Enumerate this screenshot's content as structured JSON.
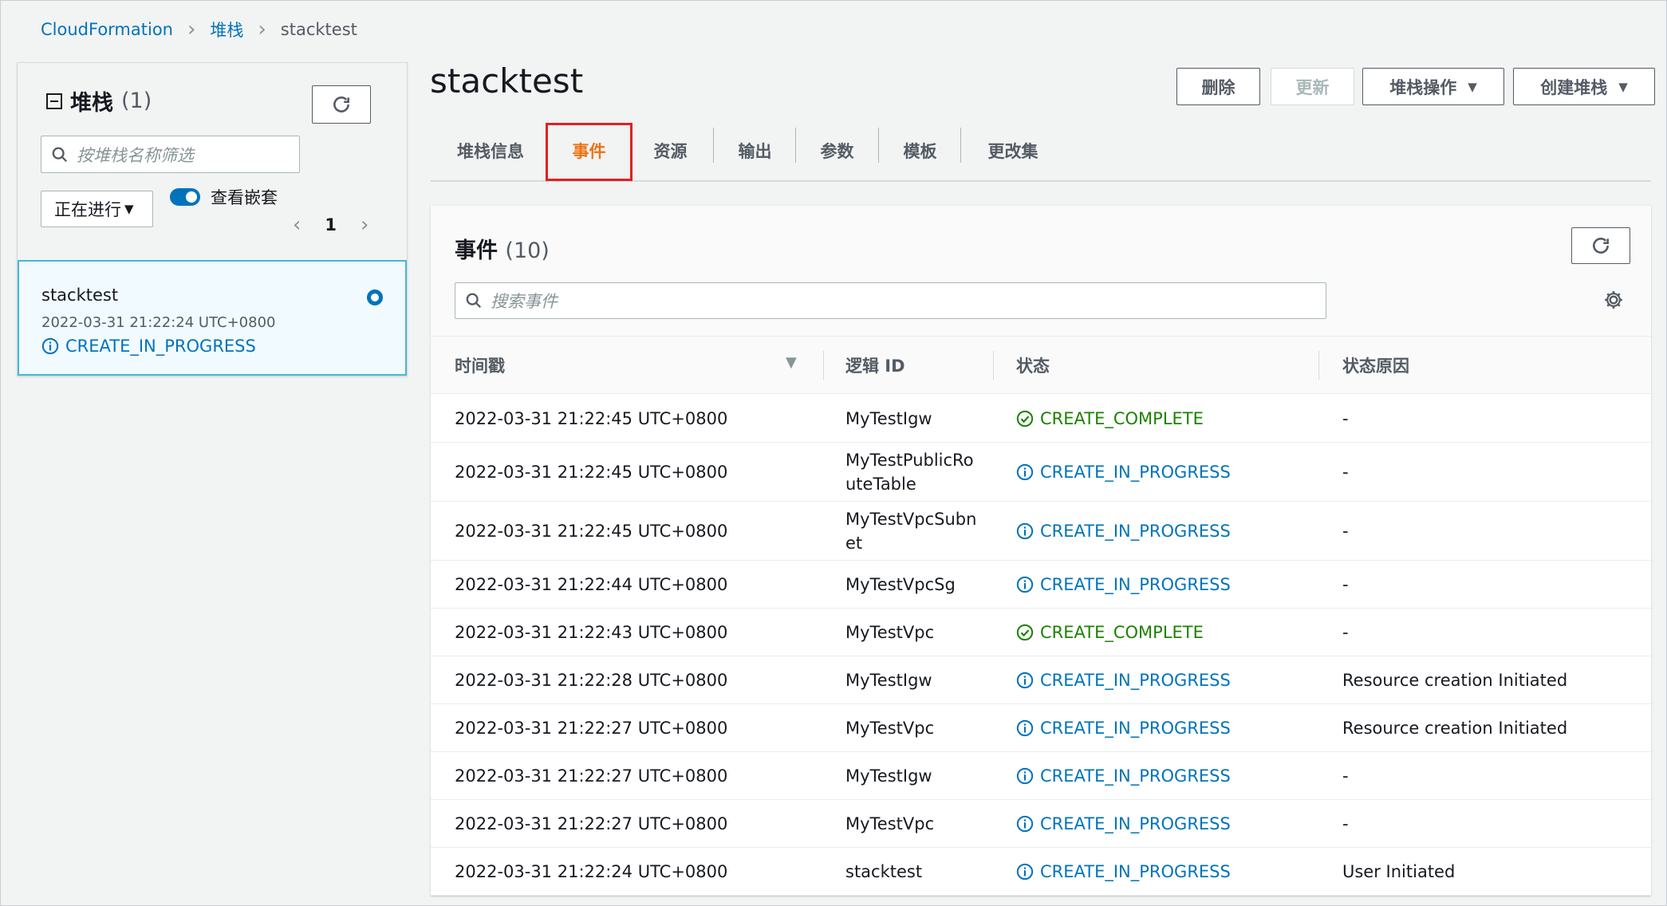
{
  "breadcrumb": {
    "root": "CloudFormation",
    "parent": "堆栈",
    "current": "stacktest"
  },
  "left_panel": {
    "title": "堆栈",
    "count": "(1)",
    "search_placeholder": "按堆栈名称筛选",
    "filter_value": "正在进行",
    "toggle_label": "查看嵌套",
    "page": "1",
    "stack": {
      "name": "stacktest",
      "date": "2022-03-31 21:22:24 UTC+0800",
      "status": "CREATE_IN_PROGRESS"
    }
  },
  "main": {
    "title": "stacktest",
    "actions": {
      "delete": "删除",
      "update": "更新",
      "ops": "堆栈操作",
      "create": "创建堆栈"
    },
    "tabs": [
      "堆栈信息",
      "事件",
      "资源",
      "输出",
      "参数",
      "模板",
      "更改集"
    ],
    "active_tab": "事件"
  },
  "events": {
    "title": "事件",
    "count": "(10)",
    "search_placeholder": "搜索事件",
    "columns": {
      "time": "时间戳",
      "id": "逻辑 ID",
      "status": "状态",
      "reason": "状态原因"
    },
    "rows": [
      {
        "time": "2022-03-31 21:22:45 UTC+0800",
        "id": "MyTestIgw",
        "status": "CREATE_COMPLETE",
        "type": "complete",
        "reason": "-"
      },
      {
        "time": "2022-03-31 21:22:45 UTC+0800",
        "id": "MyTestPublicRouteTable",
        "status": "CREATE_IN_PROGRESS",
        "type": "progress",
        "reason": "-"
      },
      {
        "time": "2022-03-31 21:22:45 UTC+0800",
        "id": "MyTestVpcSubnet",
        "status": "CREATE_IN_PROGRESS",
        "type": "progress",
        "reason": "-"
      },
      {
        "time": "2022-03-31 21:22:44 UTC+0800",
        "id": "MyTestVpcSg",
        "status": "CREATE_IN_PROGRESS",
        "type": "progress",
        "reason": "-"
      },
      {
        "time": "2022-03-31 21:22:43 UTC+0800",
        "id": "MyTestVpc",
        "status": "CREATE_COMPLETE",
        "type": "complete",
        "reason": "-"
      },
      {
        "time": "2022-03-31 21:22:28 UTC+0800",
        "id": "MyTestIgw",
        "status": "CREATE_IN_PROGRESS",
        "type": "progress",
        "reason": "Resource creation Initiated"
      },
      {
        "time": "2022-03-31 21:22:27 UTC+0800",
        "id": "MyTestVpc",
        "status": "CREATE_IN_PROGRESS",
        "type": "progress",
        "reason": "Resource creation Initiated"
      },
      {
        "time": "2022-03-31 21:22:27 UTC+0800",
        "id": "MyTestIgw",
        "status": "CREATE_IN_PROGRESS",
        "type": "progress",
        "reason": "-"
      },
      {
        "time": "2022-03-31 21:22:27 UTC+0800",
        "id": "MyTestVpc",
        "status": "CREATE_IN_PROGRESS",
        "type": "progress",
        "reason": "-"
      },
      {
        "time": "2022-03-31 21:22:24 UTC+0800",
        "id": "stacktest",
        "status": "CREATE_IN_PROGRESS",
        "type": "progress",
        "reason": "User Initiated"
      }
    ]
  },
  "colors": {
    "link": "#0073bb",
    "success": "#1d8102",
    "active_tab": "#ec7211",
    "highlight_box": "#e02020"
  }
}
